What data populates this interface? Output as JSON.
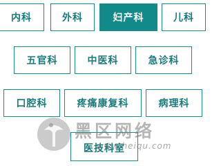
{
  "departments": {
    "row1": [
      {
        "label": "内科",
        "active": false
      },
      {
        "label": "外科",
        "active": false
      },
      {
        "label": "妇产科",
        "active": true
      },
      {
        "label": "儿科",
        "active": false
      }
    ],
    "row2": [
      {
        "label": "五官科"
      },
      {
        "label": "中医科"
      },
      {
        "label": "急诊科"
      }
    ],
    "row3": [
      {
        "label": "口腔科"
      },
      {
        "label": "疼痛康复科"
      },
      {
        "label": "病理科"
      }
    ],
    "row4": [
      {
        "label": "医技科室"
      }
    ]
  },
  "watermark": {
    "title": "黑区网络",
    "url": "www.heiqu.com"
  },
  "colors": {
    "accent": "#128a8a",
    "border": "#1a8a8a",
    "text": "#1a7a7a"
  }
}
